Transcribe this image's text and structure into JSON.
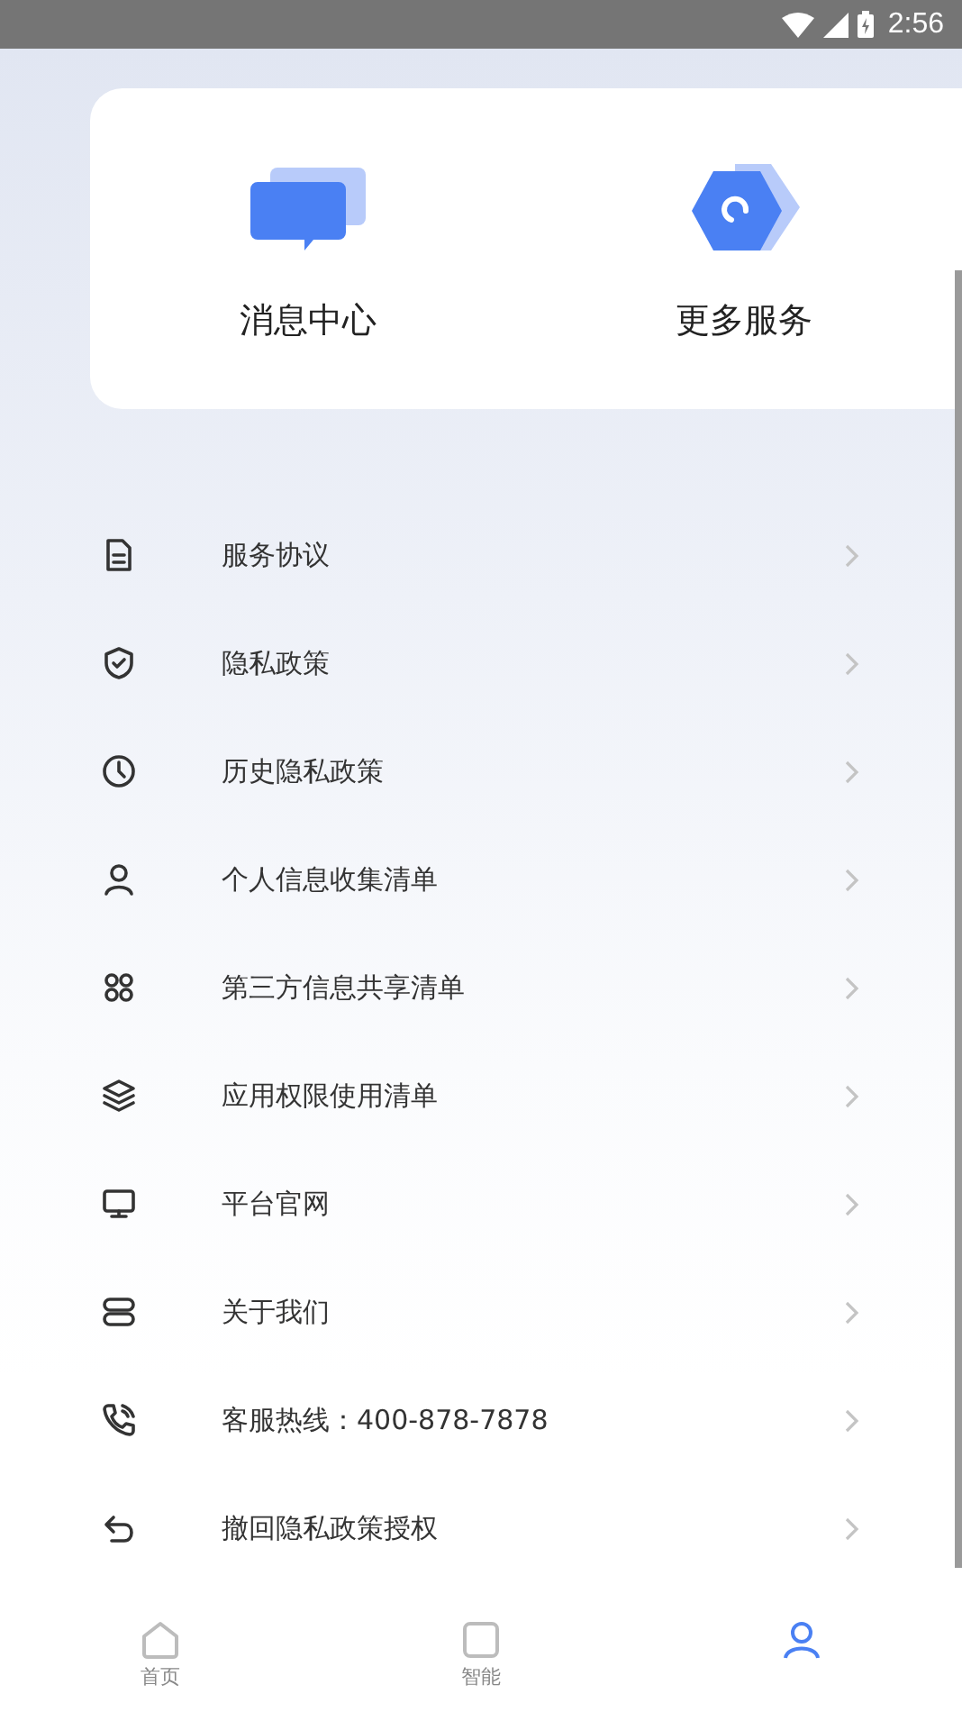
{
  "status_bar": {
    "time": "2:56"
  },
  "services": [
    {
      "label": "消息中心",
      "kind": "message"
    },
    {
      "label": "更多服务",
      "kind": "more"
    }
  ],
  "menu": [
    {
      "label": "服务协议",
      "kind": "document"
    },
    {
      "label": "隐私政策",
      "kind": "shield"
    },
    {
      "label": "历史隐私政策",
      "kind": "clock"
    },
    {
      "label": "个人信息收集清单",
      "kind": "person"
    },
    {
      "label": "第三方信息共享清单",
      "kind": "grid"
    },
    {
      "label": "应用权限使用清单",
      "kind": "layers"
    },
    {
      "label": "平台官网",
      "kind": "monitor"
    },
    {
      "label": "关于我们",
      "kind": "stack"
    },
    {
      "label": "客服热线：400-878-7878",
      "kind": "phone"
    },
    {
      "label": "撤回隐私政策授权",
      "kind": "undo"
    }
  ],
  "bottom_nav": [
    {
      "label": "首页",
      "kind": "home",
      "selected": false
    },
    {
      "label": "智能",
      "kind": "square",
      "selected": false
    },
    {
      "kind": "mine",
      "selected": true
    }
  ]
}
